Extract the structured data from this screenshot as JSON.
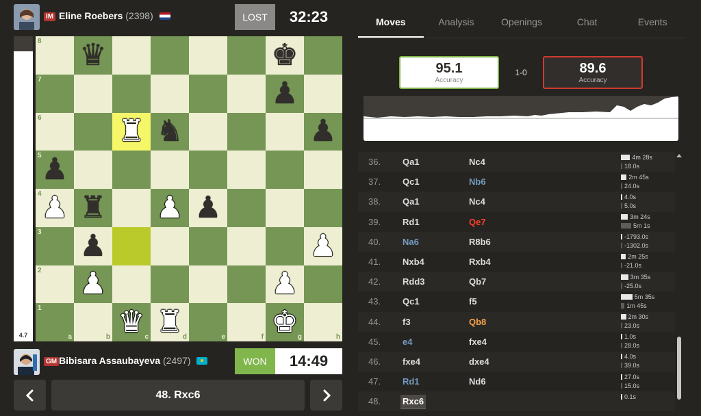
{
  "top_player": {
    "title": "IM",
    "name": "Eline Roebers",
    "rating": "(2398)",
    "flag": "nl",
    "result": "LOST",
    "clock": "32:23"
  },
  "bottom_player": {
    "title": "GM",
    "name": "Bibisara Assaubayeva",
    "rating": "(2497)",
    "flag": "kz",
    "result": "WON",
    "clock": "14:49"
  },
  "eval": {
    "score": "4.7"
  },
  "board": {
    "files": [
      "a",
      "b",
      "c",
      "d",
      "e",
      "f",
      "g",
      "h"
    ],
    "ranks": [
      "8",
      "7",
      "6",
      "5",
      "4",
      "3",
      "2",
      "1"
    ],
    "highlight": [
      "c6",
      "c3"
    ],
    "pieces": {
      "b8": "bQ",
      "g8": "bK",
      "g7": "bP",
      "c6": "wR",
      "d6": "bN",
      "h6": "bP",
      "a5": "bP",
      "a4": "wP",
      "b4": "bR",
      "d4": "wP",
      "e4": "bP",
      "b3": "bP",
      "h3": "wP",
      "b2": "wP",
      "g2": "wP",
      "c1": "wQ",
      "d1": "wR",
      "g1": "wK"
    }
  },
  "nav": {
    "prev_icon": "chevron-left-icon",
    "current_move": "48. Rxc6",
    "next_icon": "chevron-right-icon"
  },
  "tabs": [
    "Moves",
    "Analysis",
    "Openings",
    "Chat",
    "Events"
  ],
  "active_tab": "Moves",
  "accuracy": {
    "white_value": "95.1",
    "white_label": "Accuracy",
    "black_value": "89.6",
    "black_label": "Accuracy",
    "score": "1-0"
  },
  "moves": [
    {
      "num": "36.",
      "white": "Qa1",
      "black": "Nc4",
      "times": [
        "4m 28s",
        "18.0s"
      ]
    },
    {
      "num": "37.",
      "white": "Qc1",
      "black": "Nb6",
      "black_class": "blue",
      "times": [
        "2m 45s",
        "24.0s"
      ]
    },
    {
      "num": "38.",
      "white": "Qa1",
      "black": "Nc4",
      "times": [
        "4.0s",
        "5.0s"
      ]
    },
    {
      "num": "39.",
      "white": "Rd1",
      "black": "Qe7",
      "black_class": "red",
      "times": [
        "3m 24s",
        "5m 1s"
      ]
    },
    {
      "num": "40.",
      "white": "Na6",
      "white_class": "blue",
      "black": "R8b6",
      "times": [
        "-1793.0s",
        "-1302.0s"
      ]
    },
    {
      "num": "41.",
      "white": "Nxb4",
      "black": "Rxb4",
      "times": [
        "2m 25s",
        "-21.0s"
      ]
    },
    {
      "num": "42.",
      "white": "Rdd3",
      "black": "Qb7",
      "times": [
        "3m 35s",
        "-25.0s"
      ]
    },
    {
      "num": "43.",
      "white": "Qc1",
      "black": "f5",
      "times": [
        "5m 35s",
        "1m 45s"
      ]
    },
    {
      "num": "44.",
      "white": "f3",
      "black": "Qb8",
      "black_class": "orange",
      "times": [
        "2m 30s",
        "23.0s"
      ]
    },
    {
      "num": "45.",
      "white": "e4",
      "white_class": "blue",
      "black": "fxe4",
      "times": [
        "1.0s",
        "28.0s"
      ]
    },
    {
      "num": "46.",
      "white": "fxe4",
      "black": "dxe4",
      "times": [
        "4.0s",
        "39.0s"
      ]
    },
    {
      "num": "47.",
      "white": "Rd1",
      "white_class": "blue",
      "black": "Nd6",
      "times": [
        "27.0s",
        "15.0s"
      ]
    },
    {
      "num": "48.",
      "white": "Rxc6",
      "white_class": "current",
      "black": "",
      "times": [
        "0.1s"
      ]
    }
  ],
  "colors": {
    "accent_green": "#81b64c",
    "accent_red": "#d03a30",
    "board_light": "#eeeed2",
    "board_dark": "#769656",
    "best_blue": "#749bbf",
    "blunder_red": "#fa412d",
    "inaccuracy_orange": "#f7a44a"
  }
}
